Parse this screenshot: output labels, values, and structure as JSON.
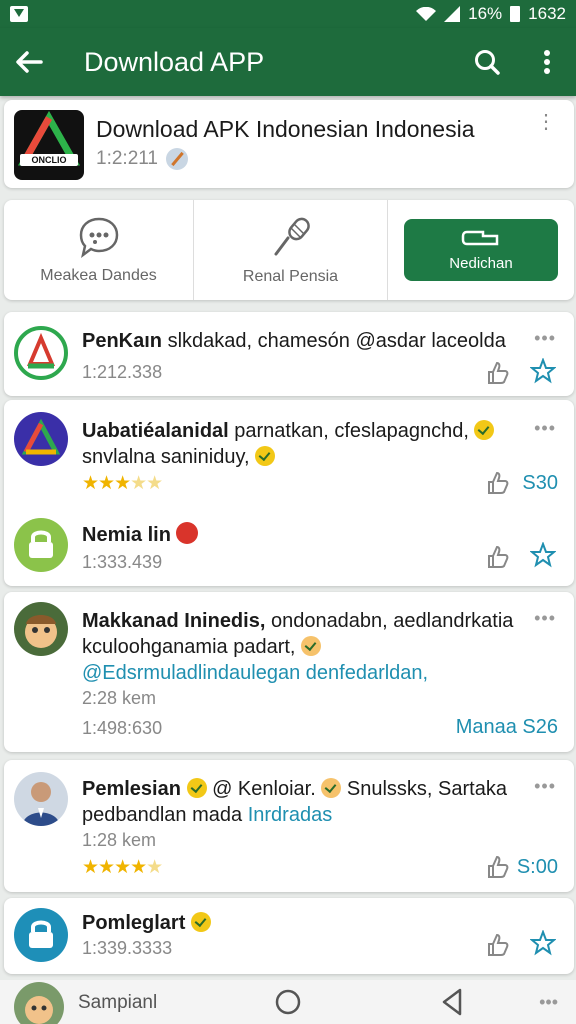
{
  "status": {
    "battery": "16%",
    "time": "1632"
  },
  "appbar": {
    "title": "Download APP"
  },
  "app": {
    "name": "Download APK Indonesian Indonesia",
    "meta": "1:2:211",
    "logo_text": "ONCLIO"
  },
  "actions": {
    "a1": "Meakea Dandes",
    "a2": "Renal Pensia",
    "a3": "Nedichan"
  },
  "posts": [
    {
      "title": "PenKaın",
      "text": " slkdakad, chamesón @asdar laceolda",
      "time": "1:212.338"
    },
    {
      "title": "Uabatiéalanidal",
      "text": " parnatkan, cfeslapagnchd,",
      "text2": "snvlalna saniniduy,",
      "count": "S30"
    },
    {
      "title": "Nemia lin",
      "time": "1:333.439"
    },
    {
      "title": "Makkanad Ininedis,",
      "text": " ondonadabn, aedlandrkatia kculoohganamia padart,",
      "link": "@Edsrmuladlindaulegan denfedarldan,",
      "time1": "2:28 kem",
      "time2": "1:498:630",
      "count": "Manaa S26"
    },
    {
      "title": "Pemlesian",
      "text": " @ Kenloiar.",
      "text_b": " Snulssks, Sartaka pedbandlan mada",
      "link": "Inrdradas",
      "time": "1:28 kem",
      "count": "S:00"
    },
    {
      "title": "Pomleglart",
      "time": "1:339.3333"
    },
    {
      "title": "Sampianl"
    }
  ],
  "colors": {
    "primary": "#1e6b3c",
    "accent": "#1f8fb0",
    "button": "#1e7a45",
    "star": "#f0b400"
  }
}
